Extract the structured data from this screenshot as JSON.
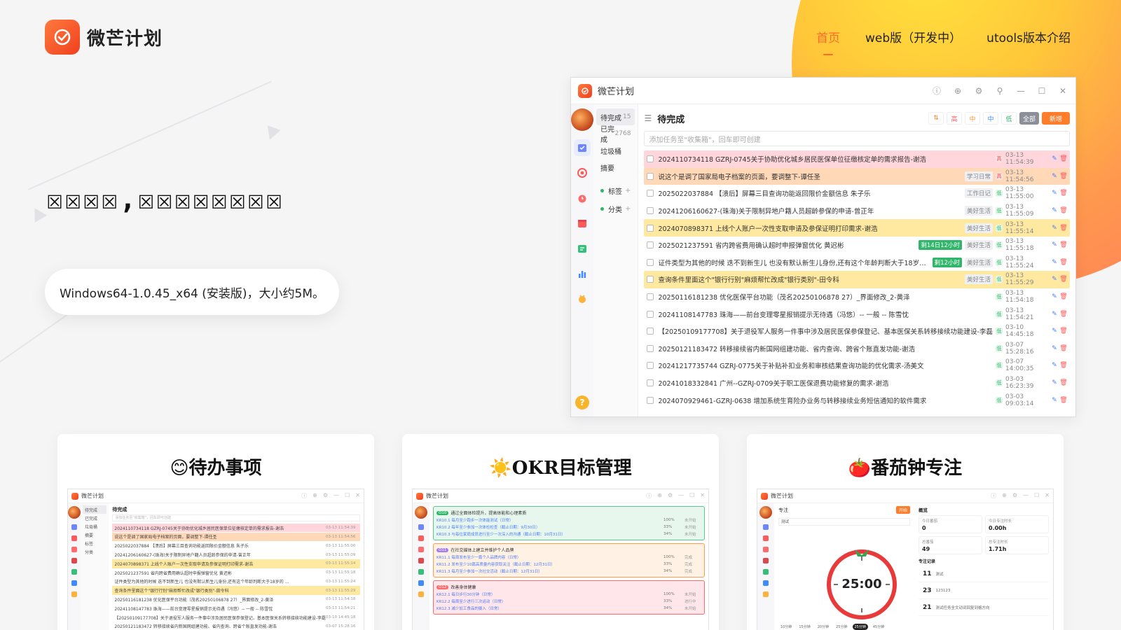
{
  "brand": {
    "name": "微芒计划",
    "accent": "#ff6a2a"
  },
  "nav": [
    {
      "label": "首页",
      "active": true
    },
    {
      "label": "web版（开发中）",
      "active": false
    },
    {
      "label": "utools版本介绍",
      "active": false
    }
  ],
  "hero": {
    "title": "☒☒☒☒,☒☒☒☒☒☒☒☒",
    "download": "Windows64-1.0.45_x64 (安装版)，大小约5M。"
  },
  "app": {
    "title": "微芒计划",
    "lists": [
      {
        "label": "待完成",
        "count": "15",
        "active": true
      },
      {
        "label": "已完成",
        "count": "2768",
        "active": false
      },
      {
        "label": "垃圾桶",
        "count": "",
        "active": false
      },
      {
        "label": "摘要",
        "count": "",
        "active": false
      }
    ],
    "groups": [
      {
        "label": "标签"
      },
      {
        "label": "分类"
      }
    ],
    "content_title": "待完成",
    "filters": [
      "⇅",
      "高",
      "中",
      "中",
      "低",
      "全部",
      "新增"
    ],
    "add_placeholder": "添加任务至\"收集箱\"，回车即可创建",
    "tasks": [
      {
        "text": "2024110734118 GZRJ-0745关于协助优化城乡居民医保单位征缴核定单的需求报告-谢浩",
        "color": "pink",
        "badge": "",
        "tag": "",
        "prio": "r",
        "time": "03-13 11:54:39"
      },
      {
        "text": "说这个是调了国家局电子档案的页面，要调整下-谭任圣",
        "color": "orange",
        "badge": "",
        "tag": "学习日常",
        "prio": "r",
        "time": "03-13 11:54:56"
      },
      {
        "text": "2025022037884 【溃后】屏幕三目查询功能返回限价金额信息 朱子乐",
        "color": "",
        "badge": "",
        "tag": "工作日记",
        "prio": "g",
        "time": "03-13 11:55:00"
      },
      {
        "text": "20241206160627-(珠海)关于限制异地户籍人员超龄参保的申请-曾正年",
        "color": "",
        "badge": "",
        "tag": "美好生活",
        "prio": "g",
        "time": "03-13 11:55:09"
      },
      {
        "text": "2024070898371 上线个人账户一次性支取申请及参保证明打印需求-谢浩",
        "color": "yellow",
        "badge": "",
        "tag": "美好生活",
        "prio": "g",
        "time": "03-13 11:55:14"
      },
      {
        "text": "2025021237591 省内跨省费用确认超时申报弹窗优化 黄迟彬",
        "color": "",
        "badge": "剩14日12小时",
        "tag": "美好生活",
        "prio": "g",
        "time": "03-13 11:55:18"
      },
      {
        "text": "证件类型为其他的时候 迭不到新生儿 也没有默认新生儿身份,还有这个年龄判断大于18岁的 ...",
        "color": "",
        "badge": "剩12小时",
        "tag": "美好生活",
        "prio": "g",
        "time": "03-13 11:55:24"
      },
      {
        "text": "查询条件里面这个\"银行行别\"麻烦帮忙改成\"银行类别\"-田令科",
        "color": "yellow",
        "badge": "",
        "tag": "美好生活",
        "prio": "g",
        "time": "03-13 11:55:29"
      },
      {
        "text": "20250116181238 优化医保平台功能（茂名20250106878 27）_界面修改_2-黄泽",
        "color": "",
        "badge": "",
        "tag": "",
        "prio": "g",
        "time": "03-13 11:54:18"
      },
      {
        "text": "20241108147783 珠海——前台变理零星报销提示无待遇（冯悠）-- 一般 -- 陈雪忱",
        "color": "",
        "badge": "",
        "tag": "",
        "prio": "g",
        "time": "03-13 11:54:21"
      },
      {
        "text": "【20250109177708】关于退役军人服务一件事中涉及居民医保参保登记、基本医保关系转移接续功能建设-李磊",
        "color": "",
        "badge": "",
        "tag": "",
        "prio": "g",
        "time": "03-10 14:45:18"
      },
      {
        "text": "20250121183472 转移接续省内新国网组建功能、省内查询、跨省个账直发功能-谢浩",
        "color": "",
        "badge": "",
        "tag": "",
        "prio": "g",
        "time": "03-07 15:28:16"
      },
      {
        "text": "20241217735744 GZRJ-0775关于补贴补扣业务和审核结果查询功能的优化需求-汤美文",
        "color": "",
        "badge": "",
        "tag": "",
        "prio": "g",
        "time": "03-07 14:00:35"
      },
      {
        "text": "20241018332841 广州--GZRJ-0709关于职工医保退费功能修复的需求-谢浩",
        "color": "",
        "badge": "",
        "tag": "",
        "prio": "g",
        "time": "03-03 16:23:39"
      },
      {
        "text": "2024070929461-GZRJ-0638 增加系统生育险办业务与转移接续业务短信通知的软件需求",
        "color": "",
        "badge": "",
        "tag": "",
        "prio": "g",
        "time": "03-03 09:03:14"
      }
    ]
  },
  "cards": [
    {
      "emoji": "😊",
      "title": "待办事项",
      "kind": "todo"
    },
    {
      "emoji": "☀️",
      "title": "OKR目标管理",
      "kind": "okr"
    },
    {
      "emoji": "🍅",
      "title": "番茄钟专注",
      "kind": "pomodoro"
    }
  ],
  "mini": {
    "title": "微芒计划",
    "todo_title": "待完成",
    "okr": [
      {
        "obj": "通过全面体检提升，提高体能和心理素质",
        "color": "#5cc58a",
        "bg": "#e8f7ee",
        "pill": "#2fb66a",
        "krs": [
          {
            "t": "KR10.1 每月至少跑步一次体能测试（日常）",
            "p": "100%",
            "s": "未开始"
          },
          {
            "t": "KR10.2 每年至少参加一次体检检查（截止日期：9月30日）",
            "p": "33%",
            "s": "未开始"
          },
          {
            "t": "KR10.3 与每位家庭成员进行至少一次深入的沟通（截止日期：10月31日）",
            "p": "34%",
            "s": "未开始"
          }
        ]
      },
      {
        "obj": "在社交媒体上建立并维护个人品牌",
        "color": "#ff9a4e",
        "bg": "#fff1e3",
        "pill": "#a97cf0",
        "krs": [
          {
            "t": "KR11.1 每周发布至少一篇个人品牌内容（日常）",
            "p": "100%",
            "s": "完成"
          },
          {
            "t": "KR11.2 发布至少10篇高质量内容获取关注（截止日期：12月31日）",
            "p": "33%",
            "s": "完成"
          },
          {
            "t": "KR11.3 每月至少参加一次社交活动（截止日期：12月31日）",
            "p": "34%",
            "s": "完成"
          }
        ]
      },
      {
        "obj": "改善身体健康",
        "color": "#ff6b6b",
        "bg": "#ffe6ea",
        "pill": "#ff6b6b",
        "krs": [
          {
            "t": "KR12.1 每日步行30分钟（日常）",
            "p": "100%",
            "s": "未开始"
          },
          {
            "t": "KR12.2 每周至少进行三次运动（日常）",
            "p": "33%",
            "s": "进行中"
          },
          {
            "t": "KR12.3 减少加工食品的摄入（日常）",
            "p": "34%",
            "s": "未开始"
          }
        ]
      }
    ],
    "pomodoro": {
      "focus_label": "专注",
      "start": "开始",
      "mode": "测试",
      "overview": "概览",
      "timer": "25:00",
      "stats": [
        {
          "l": "今日番茄",
          "v": "0"
        },
        {
          "l": "今日专注时长",
          "v": "0.00h"
        },
        {
          "l": "总番茄",
          "v": "49"
        },
        {
          "l": "总专注时长",
          "v": "1.71h"
        }
      ],
      "records_label": "专注记录",
      "records": [
        {
          "n": "11",
          "d": "测试"
        },
        {
          "n": "23",
          "d": "123123"
        },
        {
          "n": "21",
          "d": "测试任务全文动词回复到格方向"
        }
      ],
      "durations": [
        "10分钟",
        "15分钟",
        "20分钟",
        "25分钟",
        "25分钟",
        "45分钟"
      ]
    }
  }
}
